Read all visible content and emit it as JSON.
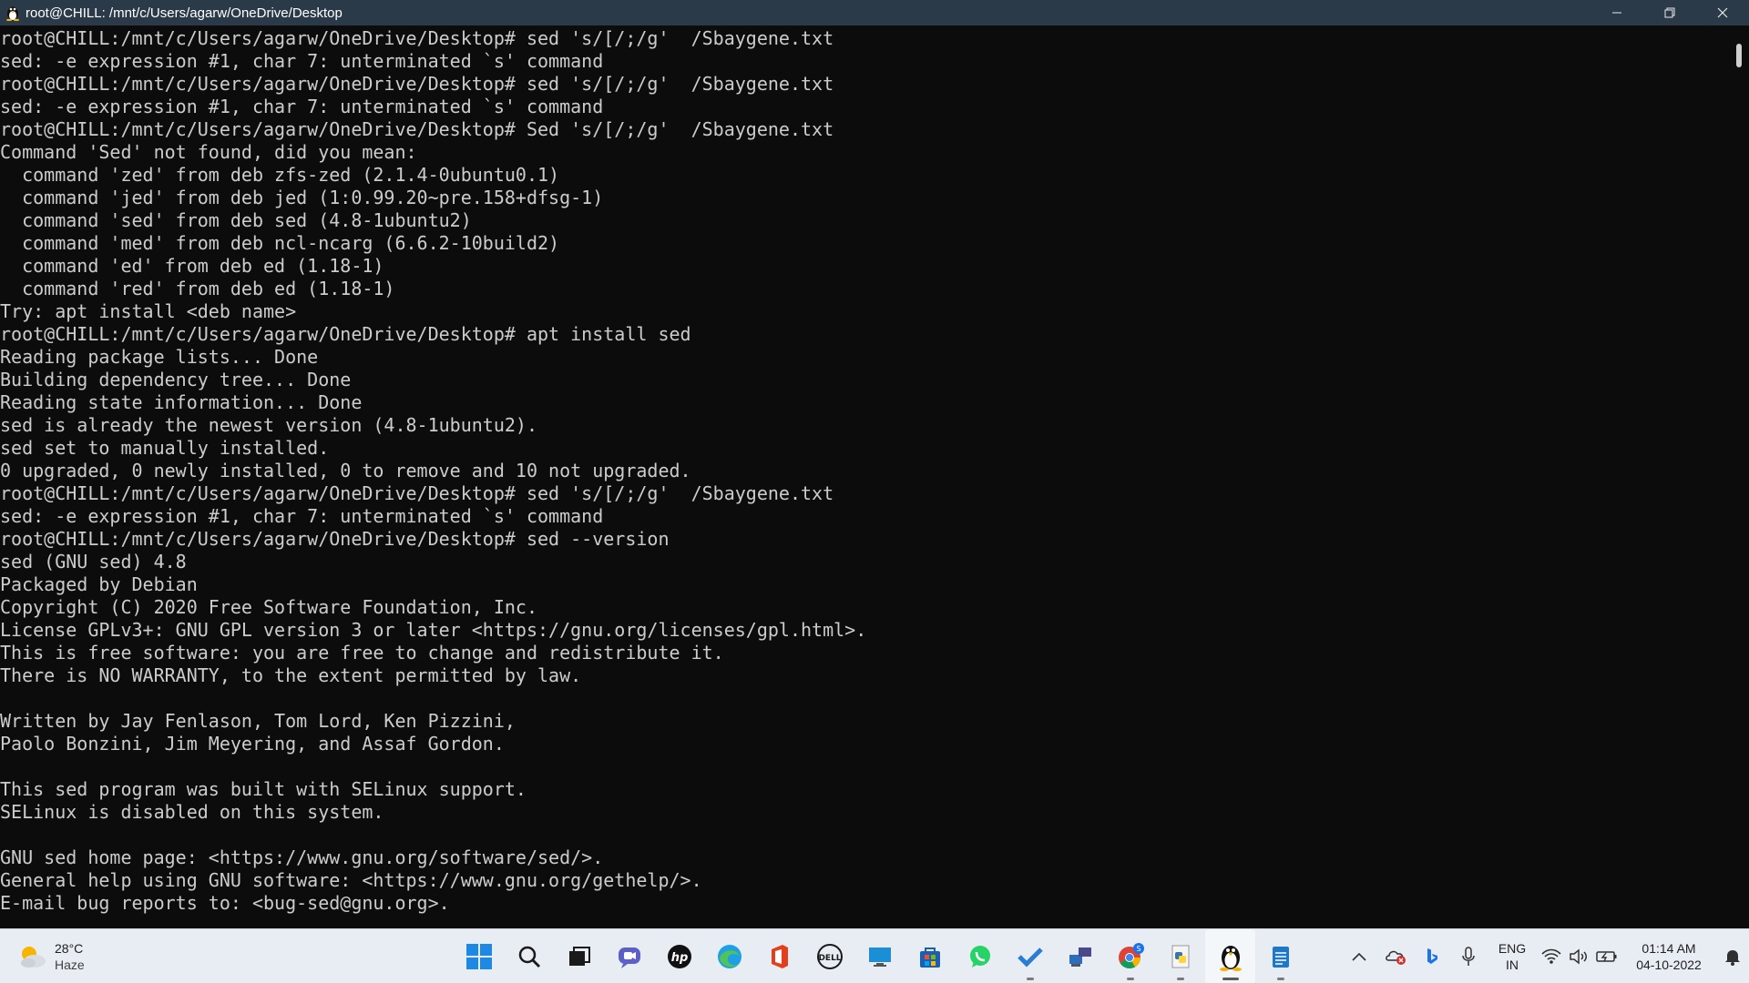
{
  "window": {
    "title": "root@CHILL: /mnt/c/Users/agarw/OneDrive/Desktop",
    "controls": {
      "minimize": "—",
      "restore": "❐",
      "close": "✕"
    }
  },
  "terminal": {
    "lines": [
      "root@CHILL:/mnt/c/Users/agarw/OneDrive/Desktop# sed 's/[/;/g'  /Sbaygene.txt",
      "sed: -e expression #1, char 7: unterminated `s' command",
      "root@CHILL:/mnt/c/Users/agarw/OneDrive/Desktop# sed 's/[/;/g'  /Sbaygene.txt",
      "sed: -e expression #1, char 7: unterminated `s' command",
      "root@CHILL:/mnt/c/Users/agarw/OneDrive/Desktop# Sed 's/[/;/g'  /Sbaygene.txt",
      "Command 'Sed' not found, did you mean:",
      "  command 'zed' from deb zfs-zed (2.1.4-0ubuntu0.1)",
      "  command 'jed' from deb jed (1:0.99.20~pre.158+dfsg-1)",
      "  command 'sed' from deb sed (4.8-1ubuntu2)",
      "  command 'med' from deb ncl-ncarg (6.6.2-10build2)",
      "  command 'ed' from deb ed (1.18-1)",
      "  command 'red' from deb ed (1.18-1)",
      "Try: apt install <deb name>",
      "root@CHILL:/mnt/c/Users/agarw/OneDrive/Desktop# apt install sed",
      "Reading package lists... Done",
      "Building dependency tree... Done",
      "Reading state information... Done",
      "sed is already the newest version (4.8-1ubuntu2).",
      "sed set to manually installed.",
      "0 upgraded, 0 newly installed, 0 to remove and 10 not upgraded.",
      "root@CHILL:/mnt/c/Users/agarw/OneDrive/Desktop# sed 's/[/;/g'  /Sbaygene.txt",
      "sed: -e expression #1, char 7: unterminated `s' command",
      "root@CHILL:/mnt/c/Users/agarw/OneDrive/Desktop# sed --version",
      "sed (GNU sed) 4.8",
      "Packaged by Debian",
      "Copyright (C) 2020 Free Software Foundation, Inc.",
      "License GPLv3+: GNU GPL version 3 or later <https://gnu.org/licenses/gpl.html>.",
      "This is free software: you are free to change and redistribute it.",
      "There is NO WARRANTY, to the extent permitted by law.",
      "",
      "Written by Jay Fenlason, Tom Lord, Ken Pizzini,",
      "Paolo Bonzini, Jim Meyering, and Assaf Gordon.",
      "",
      "This sed program was built with SELinux support.",
      "SELinux is disabled on this system.",
      "",
      "GNU sed home page: <https://www.gnu.org/software/sed/>.",
      "General help using GNU software: <https://www.gnu.org/gethelp/>.",
      "E-mail bug reports to: <bug-sed@gnu.org>."
    ]
  },
  "taskbar": {
    "weather": {
      "temp": "28°C",
      "condition": "Haze"
    },
    "apps": [
      "start-icon",
      "search-icon",
      "task-view-icon",
      "teams-chat-icon",
      "hp-icon",
      "edge-icon",
      "office-icon",
      "dell-icon",
      "remote-desktop-icon",
      "store-icon",
      "whatsapp-icon",
      "todo-icon",
      "network-manager-icon",
      "chrome-icon",
      "python-idle-icon",
      "linux-terminal-icon",
      "notepad-icon"
    ],
    "chrome_badge": "S",
    "tray": {
      "language_line1": "ENG",
      "language_line2": "IN",
      "time": "01:14 AM",
      "date": "04-10-2022"
    }
  },
  "colors": {
    "titlebar": "#2b3a48",
    "terminal_bg": "#0c0c0c",
    "terminal_fg": "#cccccc",
    "taskbar_bg": "#e7edf3"
  }
}
